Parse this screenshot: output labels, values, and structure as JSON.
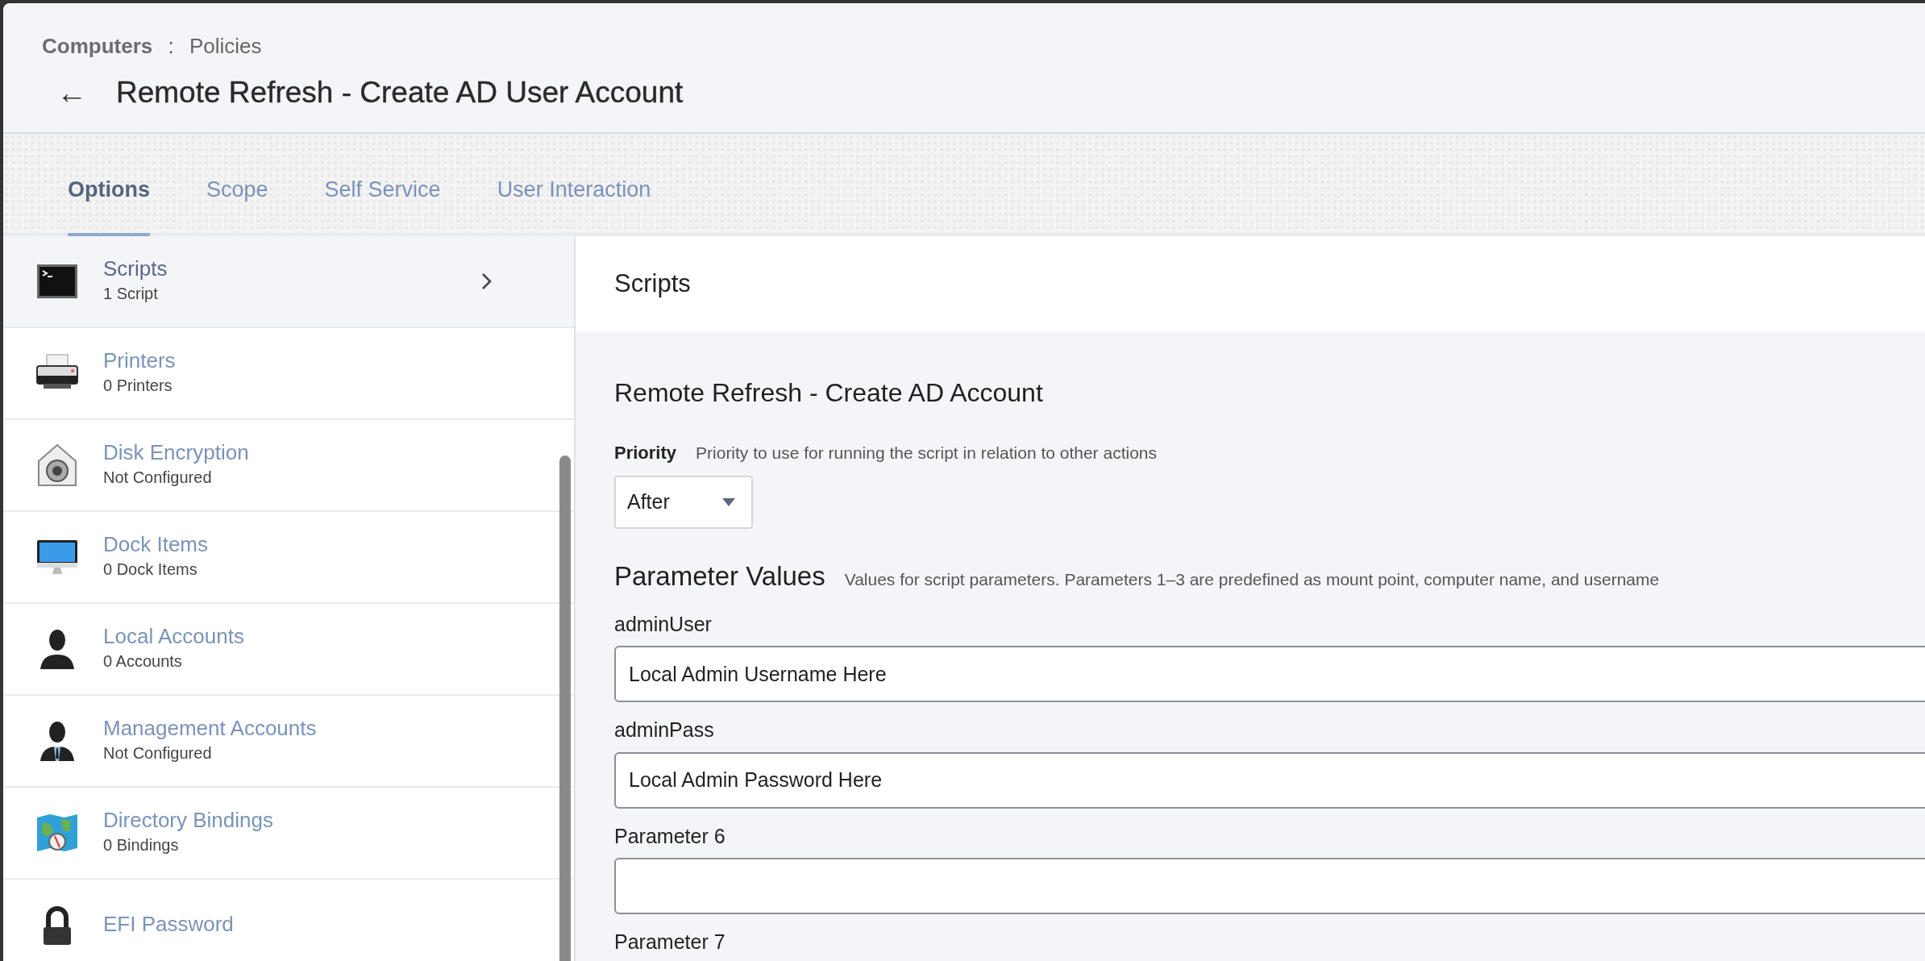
{
  "breadcrumb": {
    "parent": "Computers",
    "separator": ":",
    "current": "Policies"
  },
  "back": "←",
  "title": "Remote Refresh - Create AD User Account",
  "tabs": [
    {
      "label": "Options",
      "selected": true
    },
    {
      "label": "Scope",
      "selected": false
    },
    {
      "label": "Self Service",
      "selected": false
    },
    {
      "label": "User Interaction",
      "selected": false
    }
  ],
  "sidebar": {
    "items": [
      {
        "kind": "terminal",
        "title": "Scripts",
        "subtitle": "1 Script",
        "selected": true
      },
      {
        "kind": "printer",
        "title": "Printers",
        "subtitle": "0 Printers",
        "selected": false
      },
      {
        "kind": "vault",
        "title": "Disk Encryption",
        "subtitle": "Not Configured",
        "selected": false
      },
      {
        "kind": "monitor",
        "title": "Dock Items",
        "subtitle": "0 Dock Items",
        "selected": false
      },
      {
        "kind": "person",
        "title": "Local Accounts",
        "subtitle": "0 Accounts",
        "selected": false
      },
      {
        "kind": "manager",
        "title": "Management Accounts",
        "subtitle": "Not Configured",
        "selected": false
      },
      {
        "kind": "map",
        "title": "Directory Bindings",
        "subtitle": "0 Bindings",
        "selected": false
      },
      {
        "kind": "lock",
        "title": "EFI Password",
        "selected": false
      }
    ]
  },
  "panel": {
    "title": "Scripts",
    "script_name": "Remote Refresh - Create AD Account",
    "priority": {
      "label": "Priority",
      "hint": "Priority to use for running the script in relation to other actions",
      "value": "After"
    },
    "parameters": {
      "title": "Parameter Values",
      "hint": "Values for script parameters. Parameters 1–3 are predefined as mount point, computer name, and username",
      "fields": [
        {
          "label": "adminUser",
          "value": "Local Admin Username Here"
        },
        {
          "label": "adminPass",
          "value": "Local Admin Password Here"
        },
        {
          "label": "Parameter 6"
        },
        {
          "label": "Parameter 7"
        }
      ]
    }
  }
}
